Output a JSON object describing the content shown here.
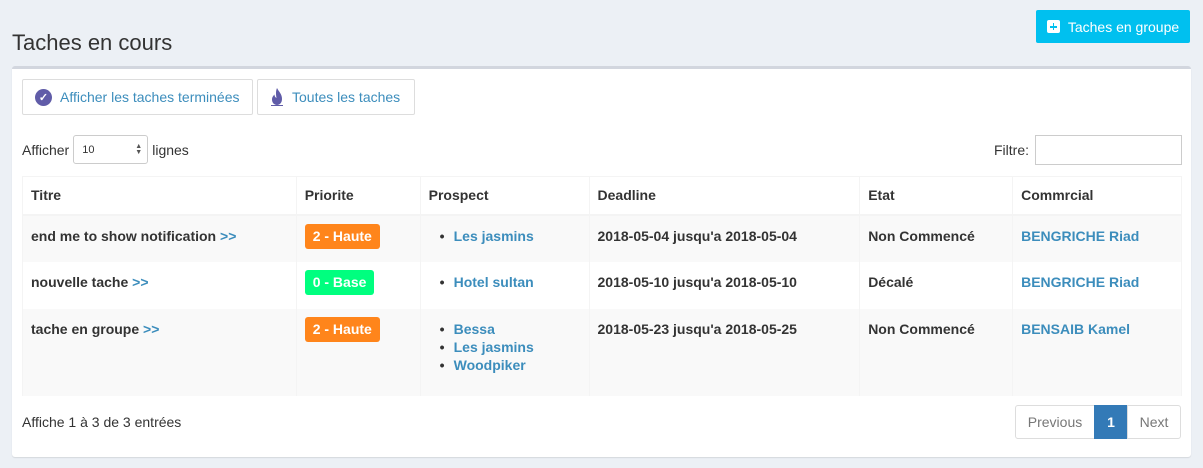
{
  "header": {
    "title": "Taches en cours",
    "group_button_label": "Taches en groupe"
  },
  "filters": {
    "completed_label": "Afficher les taches terminées",
    "all_label": "Toutes les taches"
  },
  "length": {
    "prefix": "Afficher",
    "value": "10",
    "suffix": "lignes"
  },
  "search": {
    "label": "Filtre:",
    "value": ""
  },
  "table": {
    "headers": [
      "Titre",
      "Priorite",
      "Prospect",
      "Deadline",
      "Etat",
      "Commrcial"
    ],
    "arrow": ">>",
    "rows": [
      {
        "title": "end me to show notification",
        "priority": "2 - Haute",
        "priority_color": "#ff851b",
        "prospects": [
          "Les jasmins"
        ],
        "deadline": "2018-05-04 jusqu'a 2018-05-04",
        "state": "Non Commencé",
        "commercial": "BENGRICHE Riad"
      },
      {
        "title": "nouvelle tache",
        "priority": "0 - Base",
        "priority_color": "#00ff7f",
        "prospects": [
          "Hotel sultan"
        ],
        "deadline": "2018-05-10 jusqu'a 2018-05-10",
        "state": "Décalé",
        "commercial": "BENGRICHE Riad"
      },
      {
        "title": "tache en groupe",
        "priority": "2 - Haute",
        "priority_color": "#ff851b",
        "prospects": [
          "Bessa",
          "Les jasmins",
          "Woodpiker"
        ],
        "deadline": "2018-05-23 jusqu'a 2018-05-25",
        "state": "Non Commencé",
        "commercial": "BENSAIB Kamel"
      }
    ]
  },
  "info": "Affiche 1 à 3 de 3 entrées",
  "pagination": {
    "previous": "Previous",
    "current": "1",
    "next": "Next"
  },
  "colors": {
    "accent": "#00c0ef",
    "link": "#3c8dbc",
    "active_page": "#337ab7",
    "icon_purple": "#605ca8"
  }
}
